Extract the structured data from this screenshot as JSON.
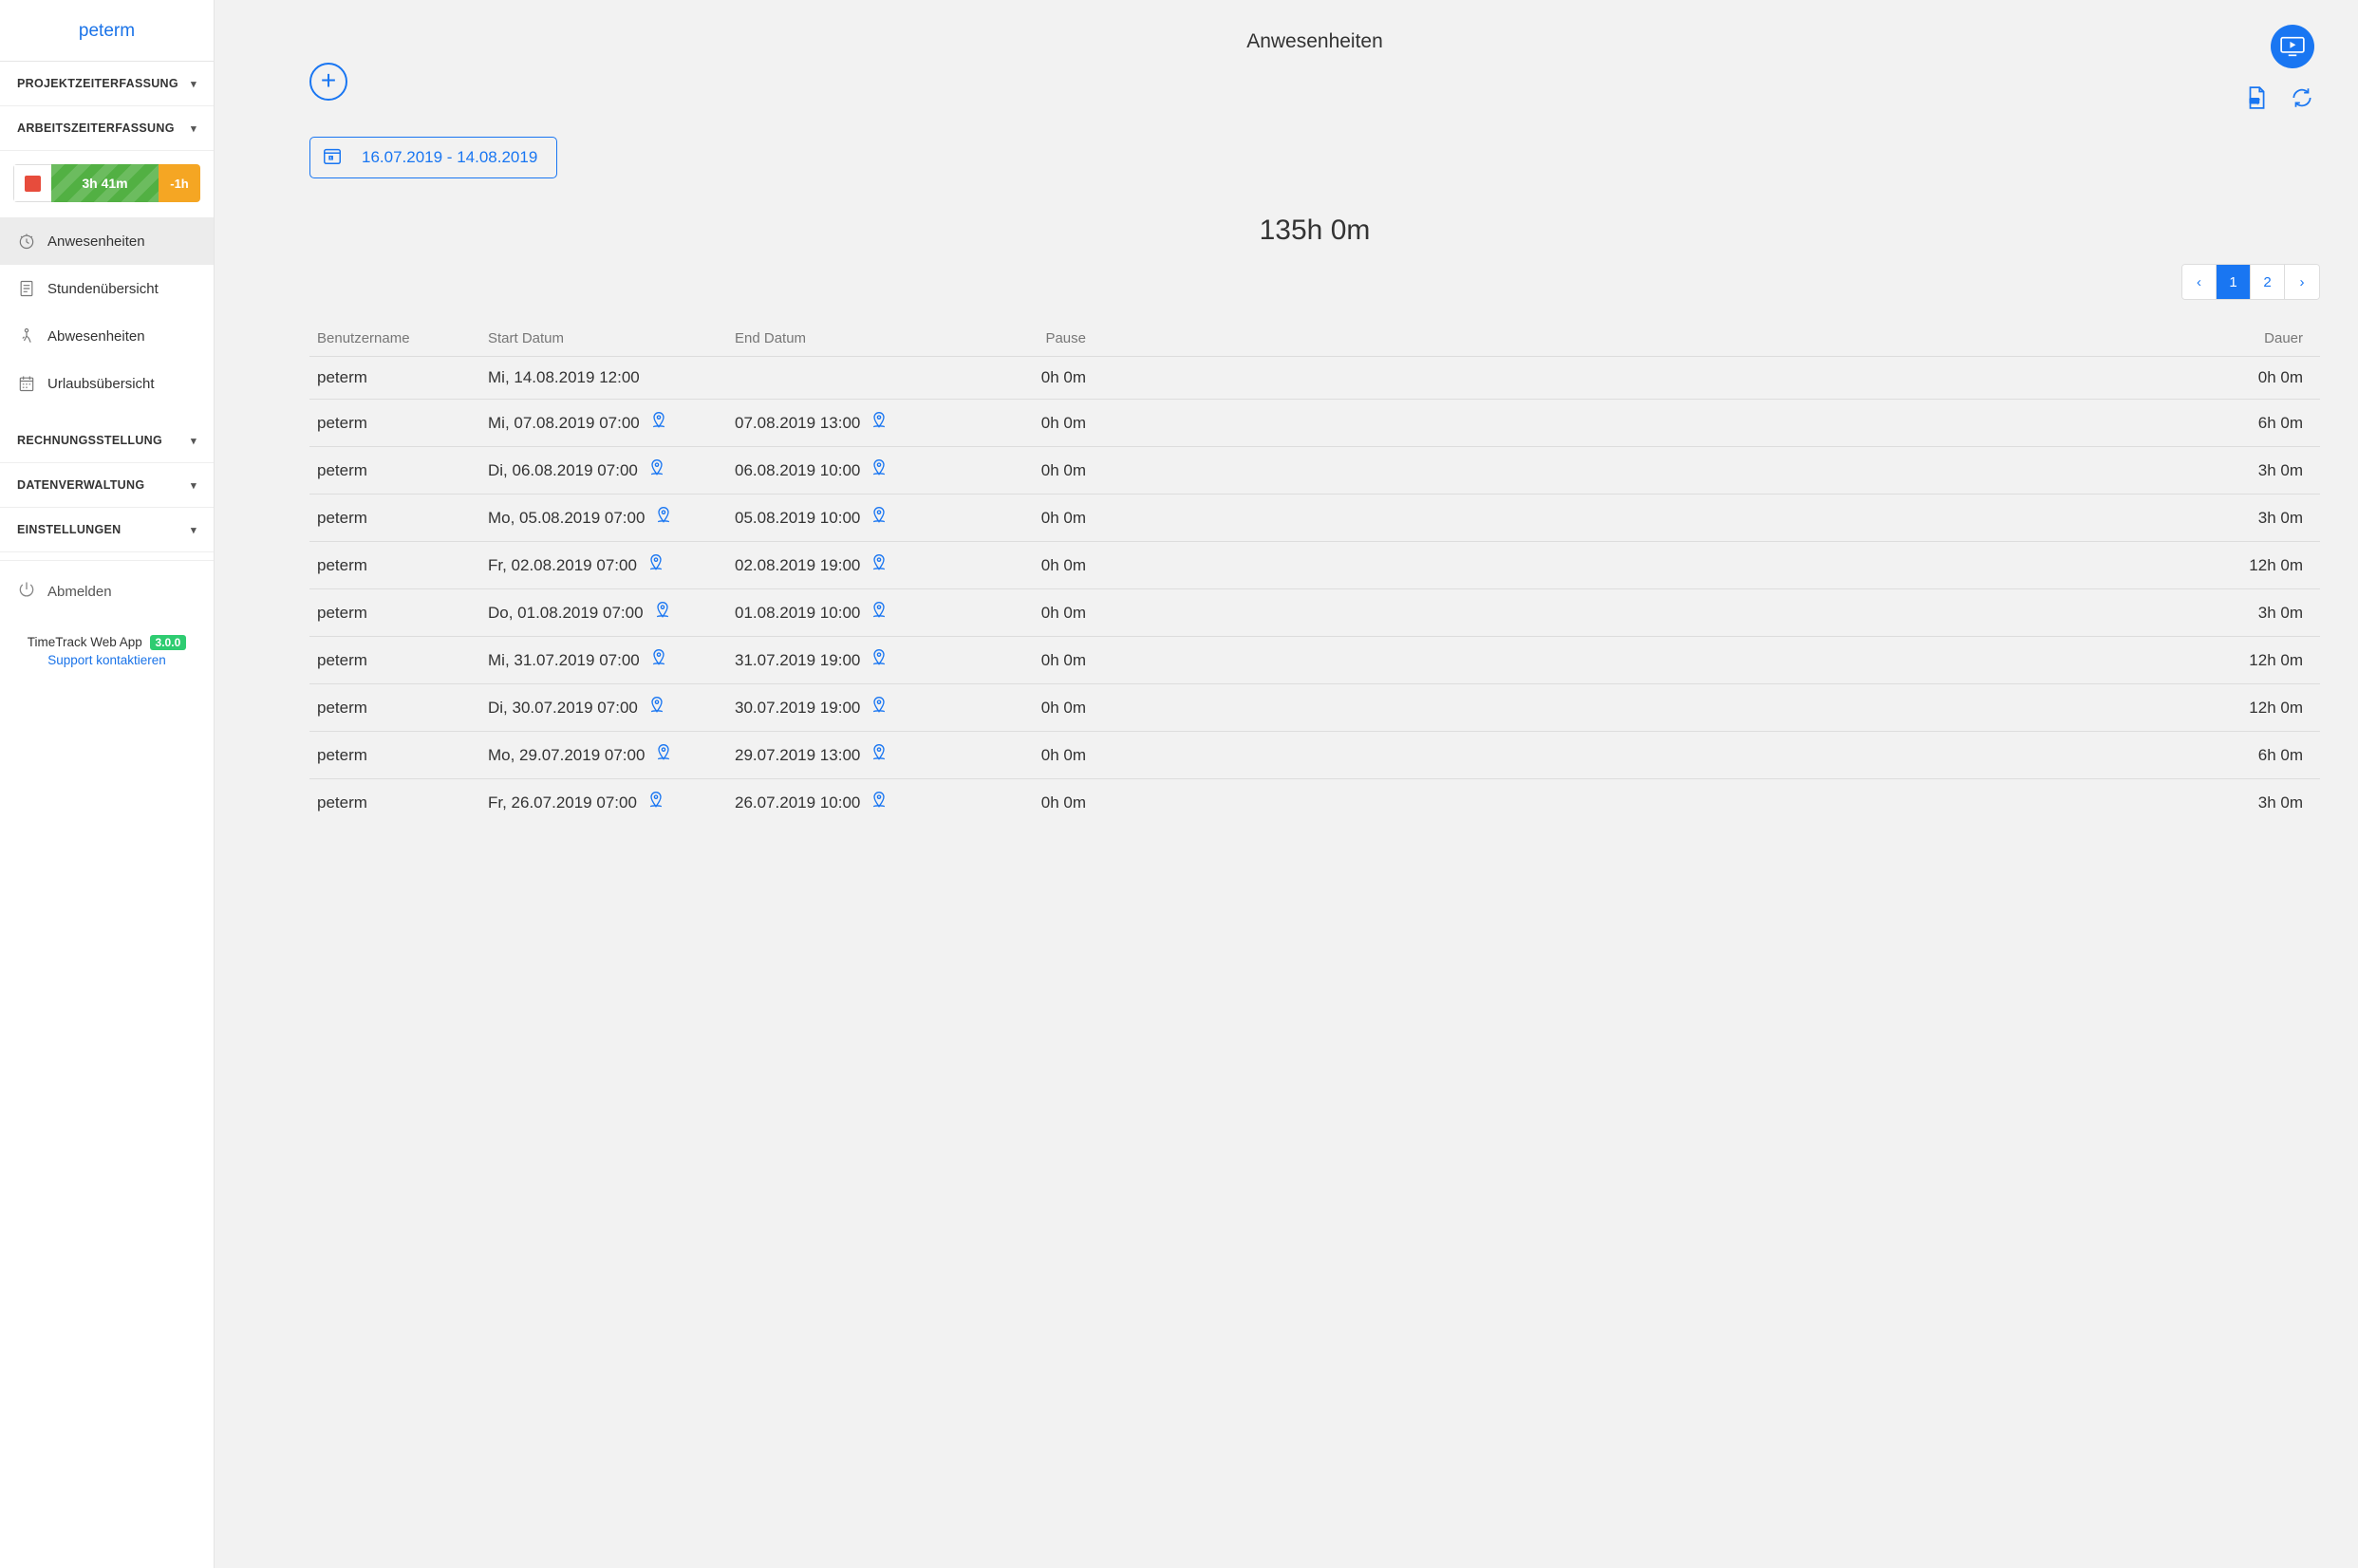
{
  "user": "peterm",
  "sidebar": {
    "sections": {
      "project": "PROJEKTZEITERFASSUNG",
      "worktime": "ARBEITSZEITERFASSUNG",
      "billing": "RECHNUNGSSTELLUNG",
      "data": "DATENVERWALTUNG",
      "settings": "EINSTELLUNGEN"
    },
    "widget": {
      "elapsed": "3h 41m",
      "overtime": "-1h"
    },
    "items": {
      "attendance": "Anwesenheiten",
      "hours": "Stundenübersicht",
      "absence": "Abwesenheiten",
      "vacation": "Urlaubsübersicht"
    },
    "logout": "Abmelden",
    "footer": {
      "app": "TimeTrack Web App",
      "version": "3.0.0",
      "support": "Support kontaktieren"
    }
  },
  "main": {
    "title": "Anwesenheiten",
    "date_range": "16.07.2019 - 14.08.2019",
    "total": "135h 0m",
    "pager": {
      "prev": "‹",
      "pages": [
        "1",
        "2"
      ],
      "next": "›",
      "active": "1"
    },
    "columns": {
      "user": "Benutzername",
      "start": "Start Datum",
      "end": "End Datum",
      "pause": "Pause",
      "dur": "Dauer"
    },
    "rows": [
      {
        "user": "peterm",
        "start": "Mi, 14.08.2019 12:00",
        "start_loc": false,
        "end": "",
        "end_loc": false,
        "pause": "0h 0m",
        "dur": "0h 0m"
      },
      {
        "user": "peterm",
        "start": "Mi, 07.08.2019 07:00",
        "start_loc": true,
        "end": "07.08.2019 13:00",
        "end_loc": true,
        "pause": "0h 0m",
        "dur": "6h 0m"
      },
      {
        "user": "peterm",
        "start": "Di, 06.08.2019 07:00",
        "start_loc": true,
        "end": "06.08.2019 10:00",
        "end_loc": true,
        "pause": "0h 0m",
        "dur": "3h 0m"
      },
      {
        "user": "peterm",
        "start": "Mo, 05.08.2019 07:00",
        "start_loc": true,
        "end": "05.08.2019 10:00",
        "end_loc": true,
        "pause": "0h 0m",
        "dur": "3h 0m"
      },
      {
        "user": "peterm",
        "start": "Fr, 02.08.2019 07:00",
        "start_loc": true,
        "end": "02.08.2019 19:00",
        "end_loc": true,
        "pause": "0h 0m",
        "dur": "12h 0m"
      },
      {
        "user": "peterm",
        "start": "Do, 01.08.2019 07:00",
        "start_loc": true,
        "end": "01.08.2019 10:00",
        "end_loc": true,
        "pause": "0h 0m",
        "dur": "3h 0m"
      },
      {
        "user": "peterm",
        "start": "Mi, 31.07.2019 07:00",
        "start_loc": true,
        "end": "31.07.2019 19:00",
        "end_loc": true,
        "pause": "0h 0m",
        "dur": "12h 0m"
      },
      {
        "user": "peterm",
        "start": "Di, 30.07.2019 07:00",
        "start_loc": true,
        "end": "30.07.2019 19:00",
        "end_loc": true,
        "pause": "0h 0m",
        "dur": "12h 0m"
      },
      {
        "user": "peterm",
        "start": "Mo, 29.07.2019 07:00",
        "start_loc": true,
        "end": "29.07.2019 13:00",
        "end_loc": true,
        "pause": "0h 0m",
        "dur": "6h 0m"
      },
      {
        "user": "peterm",
        "start": "Fr, 26.07.2019 07:00",
        "start_loc": true,
        "end": "26.07.2019 10:00",
        "end_loc": true,
        "pause": "0h 0m",
        "dur": "3h 0m"
      }
    ]
  }
}
